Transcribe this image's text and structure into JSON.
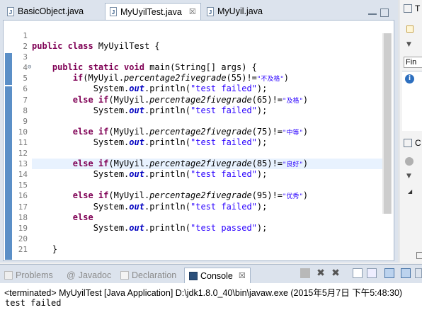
{
  "editor": {
    "tabs": [
      {
        "label": "BasicObject.java",
        "active": false
      },
      {
        "label": "MyUyilTest.java",
        "active": true,
        "close": "☒"
      },
      {
        "label": "MyUyil.java",
        "active": false
      }
    ],
    "line_numbers": [
      "1",
      "2",
      "3",
      "4",
      "5",
      "6",
      "7",
      "8",
      "9",
      "10",
      "11",
      "12",
      "13",
      "14",
      "15",
      "16",
      "17",
      "18",
      "19",
      "20",
      "21"
    ],
    "fold_marker": "⊖"
  },
  "code": {
    "l2_kw": "public class",
    "l2_rest": " MyUyilTest {",
    "l4_indent": "    ",
    "l4_kw": "public static void",
    "l4_rest": " main(String[] args) {",
    "if_kw": "if",
    "elseif_kw": "else if",
    "else_kw": "else",
    "call_prefix": "(MyUyil.",
    "method": "percentage2fivegrade",
    "ne": ")!=",
    "close_paren": ")",
    "sys": "System.",
    "out": "out",
    "println_open": ".println(",
    "println_close": ");",
    "test_failed": "\"test failed\"",
    "test_passed": "\"test passed\"",
    "args": [
      "55",
      "65",
      "75",
      "85",
      "95"
    ],
    "grades": [
      "\"不及格\"",
      "\"及格\"",
      "\"中等\"",
      "\"良好\"",
      "\"优秀\""
    ],
    "close_brace": "}"
  },
  "bottom": {
    "tabs": [
      {
        "label": "Problems"
      },
      {
        "label": "Javadoc",
        "prefix": "@"
      },
      {
        "label": "Declaration"
      },
      {
        "label": "Console",
        "close": "☒"
      }
    ],
    "terminated": "<terminated> MyUyilTest [Java Application] D:\\jdk1.8.0_40\\bin\\javaw.exe (2015年5月7日 下午5:48:30)",
    "output": "test failed"
  },
  "right_panel": {
    "labels": [
      "T",
      "Fin",
      "C"
    ]
  },
  "colors": {
    "keyword": "#7f0055",
    "string": "#2a00ff",
    "field": "#0000c0",
    "highlight": "#e8f2fe",
    "chrome": "#dce3ed"
  }
}
